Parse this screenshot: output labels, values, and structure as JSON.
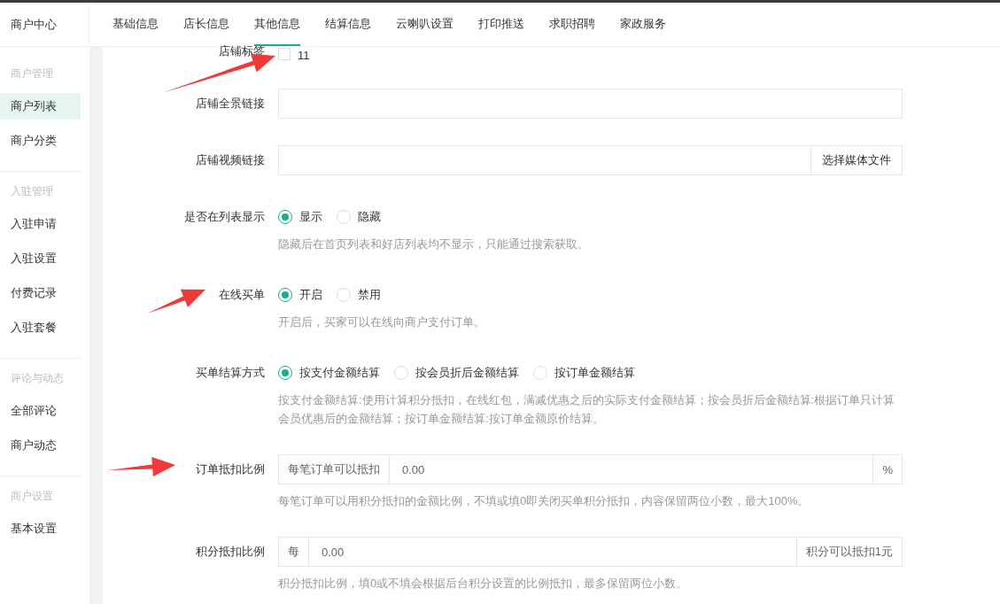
{
  "sidebar": {
    "title": "商户中心",
    "groups": [
      {
        "heading": "商户管理",
        "items": [
          {
            "label": "商户列表",
            "selected": true
          },
          {
            "label": "商户分类",
            "selected": false
          }
        ]
      },
      {
        "heading": "入驻管理",
        "items": [
          {
            "label": "入驻申请",
            "selected": false
          },
          {
            "label": "入驻设置",
            "selected": false
          },
          {
            "label": "付费记录",
            "selected": false
          },
          {
            "label": "入驻套餐",
            "selected": false
          }
        ]
      },
      {
        "heading": "评论与动态",
        "items": [
          {
            "label": "全部评论",
            "selected": false
          },
          {
            "label": "商户动态",
            "selected": false
          }
        ]
      },
      {
        "heading": "商户设置",
        "items": [
          {
            "label": "基本设置",
            "selected": false
          }
        ]
      }
    ]
  },
  "tabs": [
    {
      "label": "基础信息",
      "selected": false
    },
    {
      "label": "店长信息",
      "selected": false
    },
    {
      "label": "其他信息",
      "selected": true
    },
    {
      "label": "结算信息",
      "selected": false
    },
    {
      "label": "云喇叭设置",
      "selected": false
    },
    {
      "label": "打印推送",
      "selected": false
    },
    {
      "label": "求职招聘",
      "selected": false
    },
    {
      "label": "家政服务",
      "selected": false
    }
  ],
  "form": {
    "rows": [
      {
        "kind": "checkbox",
        "label": "店铺标签",
        "options": [
          {
            "label": "11",
            "checked": false
          }
        ]
      },
      {
        "kind": "text",
        "label": "店铺全景链接"
      },
      {
        "kind": "text-button",
        "label": "店铺视频链接",
        "button": "选择媒体文件"
      },
      {
        "kind": "radio",
        "label": "是否在列表显示",
        "options": [
          {
            "label": "显示",
            "selected": true
          },
          {
            "label": "隐藏",
            "selected": false
          }
        ],
        "help": "隐藏后在首页列表和好店列表均不显示，只能通过搜索获取。"
      },
      {
        "kind": "radio",
        "label": "在线买单",
        "options": [
          {
            "label": "开启",
            "selected": true
          },
          {
            "label": "禁用",
            "selected": false
          }
        ],
        "help": "开启后，买家可以在线向商户支付订单。"
      },
      {
        "kind": "radio",
        "label": "买单结算方式",
        "options": [
          {
            "label": "按支付金额结算",
            "selected": true
          },
          {
            "label": "按会员折后金额结算",
            "selected": false
          },
          {
            "label": "按订单金额结算",
            "selected": false
          }
        ],
        "help": "按支付金额结算:使用计算积分抵扣，在线红包，满减优惠之后的实际支付金额结算；按会员折后金额结算:根据订单只计算会员优惠后的金额结算；按订单金额结算:按订单金额原价结算。"
      },
      {
        "kind": "addon",
        "label": "订单抵扣比例",
        "prefix": "每笔订单可以抵扣",
        "value": "0.00",
        "suffix": "%",
        "help": "每笔订单可以用积分抵扣的金额比例，不填或填0即关闭买单积分抵扣，内容保留两位小数，最大100%。"
      },
      {
        "kind": "addon",
        "label": "积分抵扣比例",
        "prefix": "每",
        "value": "0.00",
        "suffix": "积分可以抵扣1元",
        "help": "积分抵扣比例，填0或不填会根据后台积分设置的比例抵扣，最多保留两位小数。"
      }
    ]
  }
}
